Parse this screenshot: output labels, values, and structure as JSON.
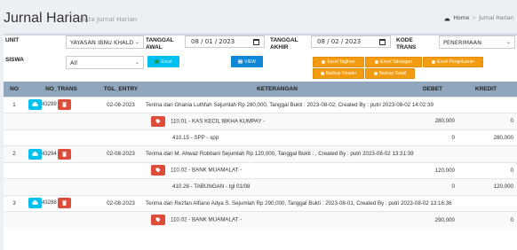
{
  "header": {
    "title": "Jurnal Harian",
    "subtitle": "Data Jurnal Harian",
    "breadcrumb": {
      "home": "Home",
      "current": "Jurnal Harian"
    }
  },
  "filters": {
    "unit_label": "UNIT",
    "unit_value": "YAYASAN IBNU KHALD",
    "siswa_label": "SISWA",
    "siswa_value": "All",
    "tanggal_awal_label_1": "TANGGAL",
    "tanggal_awal_label_2": "AWAL",
    "tanggal_awal_value": "08 / 01 / 2023",
    "tanggal_akhir_label_1": "TANGGAL",
    "tanggal_akhir_label_2": "AKHIR",
    "tanggal_akhir_value": "08 / 02 / 2023",
    "kode_trans_label_1": "KODE",
    "kode_trans_label_2": "TRANS",
    "kode_trans_value": "PENERIMAAN"
  },
  "buttons": {
    "excel": "Excel",
    "view": "VIEW",
    "excel_tagihan": "Excel Tagihan",
    "excel_tabungan": "Excel Tabungan",
    "excel_pengeluaran": "Excel Pengeluaran",
    "backup_header": "Backup Header",
    "backup_detail": "Backup Detail"
  },
  "table": {
    "columns": {
      "no": "NO",
      "no_trans": "NO_TRANS",
      "tgl_entry": "TGL_ENTRY",
      "keterangan": "KETERANGAN",
      "debet": "DEBET",
      "kredit": "KREDIT"
    },
    "rows": [
      {
        "no": "1",
        "trans": "43299",
        "tgl": "02-08-2023",
        "ket": "Terima dari Ghania Luthfah Sejumlah Rp 280,000, Tanggal Bukti : 2023-08-02, Created By : putri 2023-08-02 14:02:39"
      },
      {
        "ket": "110.01 - KAS KECIL IBKHA KUMPAY -",
        "debet": "280,000",
        "kredit": "0"
      },
      {
        "ket": "410.15 - SPP - spp",
        "debet": "0",
        "kredit": "280,000"
      },
      {
        "no": "2",
        "trans": "43294",
        "tgl": "02-08-2023",
        "ket": "Terima dari M. Ahwaz Robbani Sejumlah Rp 120,000, Tanggal Bukti : , Created By : putri 2023-08-02 13:31:39"
      },
      {
        "ket": "110.02 - BANK MUAMALAT -",
        "debet": "120,000",
        "kredit": "0"
      },
      {
        "ket": "410.26 - TABUNGAN - tgl 01/08",
        "debet": "0",
        "kredit": "120,000"
      },
      {
        "no": "3",
        "trans": "43288",
        "tgl": "02-08-2023",
        "ket": "Terima dari Rezfan Alfiano Adya S. Sejumlah Rp 290,000, Tanggal Bukti : 2023-08-01, Created By : putri 2023-08-02 13:16:36"
      },
      {
        "ket": "110.02 - BANK MUAMALAT -",
        "debet": "290,000",
        "kredit": "0"
      }
    ]
  }
}
